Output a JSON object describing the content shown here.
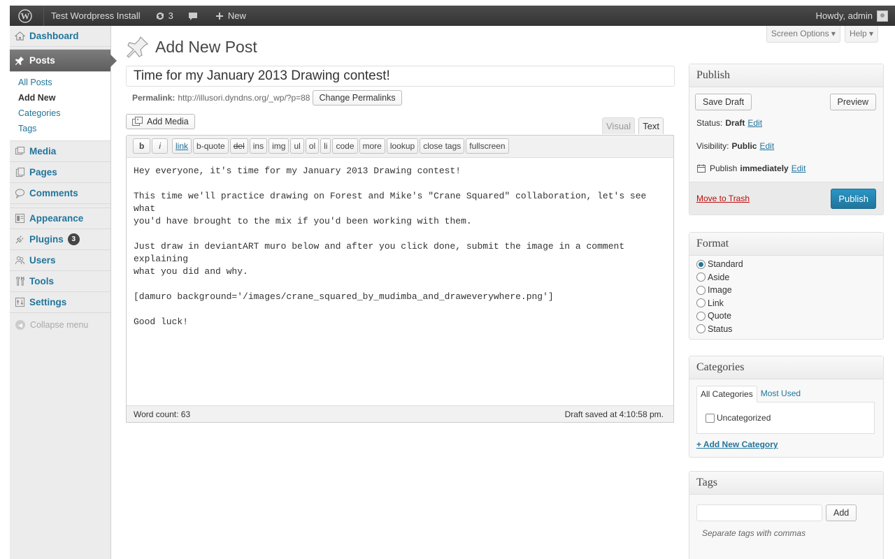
{
  "admin_bar": {
    "site_name": "Test Wordpress Install",
    "updates_count": "3",
    "new_label": "New",
    "howdy": "Howdy, admin"
  },
  "sidebar": {
    "dashboard": "Dashboard",
    "posts": "Posts",
    "posts_sub": [
      "All Posts",
      "Add New",
      "Categories",
      "Tags"
    ],
    "media": "Media",
    "pages": "Pages",
    "comments": "Comments",
    "appearance": "Appearance",
    "plugins": "Plugins",
    "plugins_badge": "3",
    "users": "Users",
    "tools": "Tools",
    "settings": "Settings",
    "collapse": "Collapse menu"
  },
  "header": {
    "screen_options": "Screen Options ▾",
    "help": "Help ▾",
    "title": "Add New Post"
  },
  "post": {
    "title": "Time for my January 2013 Drawing contest!",
    "permalink_label": "Permalink:",
    "permalink_url": "http://illusori.dyndns.org/_wp/?p=88",
    "change_permalinks": "Change Permalinks",
    "add_media": "Add Media",
    "tab_visual": "Visual",
    "tab_text": "Text",
    "quicktags": [
      "b",
      "i",
      "link",
      "b-quote",
      "del",
      "ins",
      "img",
      "ul",
      "ol",
      "li",
      "code",
      "more",
      "lookup",
      "close tags",
      "fullscreen"
    ],
    "content": "Hey everyone, it's time for my January 2013 Drawing contest!\n\nThis time we'll practice drawing on Forest and Mike's \"Crane Squared\" collaboration, let's see what\nyou'd have brought to the mix if you'd been working with them.\n\nJust draw in deviantART muro below and after you click done, submit the image in a comment explaining\nwhat you did and why.\n\n[damuro background='/images/crane_squared_by_mudimba_and_draweverywhere.png']\n\nGood luck!",
    "word_count": "Word count: 63",
    "draft_saved": "Draft saved at 4:10:58 pm."
  },
  "publish": {
    "heading": "Publish",
    "save_draft": "Save Draft",
    "preview": "Preview",
    "status_label": "Status:",
    "status_value": "Draft",
    "visibility_label": "Visibility:",
    "visibility_value": "Public",
    "publish_label": "Publish",
    "publish_value": "immediately",
    "edit": "Edit",
    "move_to_trash": "Move to Trash",
    "publish_button": "Publish"
  },
  "format": {
    "heading": "Format",
    "options": [
      "Standard",
      "Aside",
      "Image",
      "Link",
      "Quote",
      "Status"
    ],
    "selected": "Standard"
  },
  "categories": {
    "heading": "Categories",
    "tab_all": "All Categories",
    "tab_used": "Most Used",
    "items": [
      "Uncategorized"
    ],
    "add_new": "+ Add New Category"
  },
  "tags": {
    "heading": "Tags",
    "add": "Add",
    "hint": "Separate tags with commas"
  }
}
